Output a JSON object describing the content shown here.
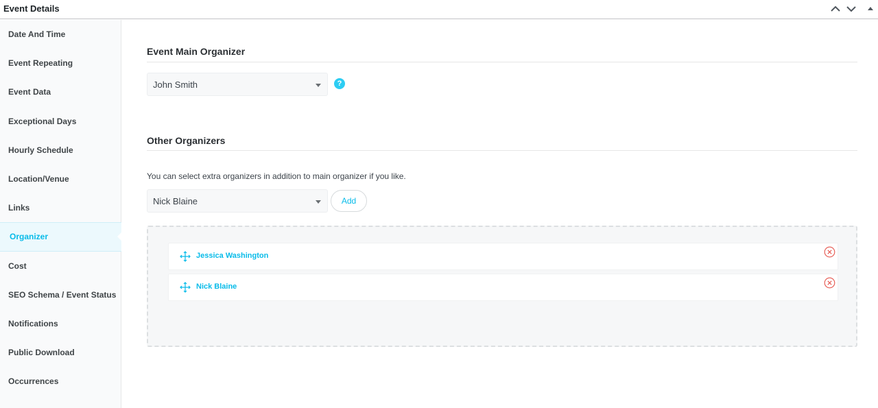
{
  "header": {
    "title": "Event Details",
    "controls": [
      "chevron-up-icon",
      "chevron-down-icon",
      "triangle-up-icon"
    ]
  },
  "sidebar": {
    "items": [
      {
        "label": "Date And Time",
        "active": false
      },
      {
        "label": "Event Repeating",
        "active": false
      },
      {
        "label": "Event Data",
        "active": false
      },
      {
        "label": "Exceptional Days",
        "active": false
      },
      {
        "label": "Hourly Schedule",
        "active": false
      },
      {
        "label": "Location/Venue",
        "active": false
      },
      {
        "label": "Links",
        "active": false
      },
      {
        "label": "Organizer",
        "active": true
      },
      {
        "label": "Cost",
        "active": false
      },
      {
        "label": "SEO Schema / Event Status",
        "active": false
      },
      {
        "label": "Notifications",
        "active": false
      },
      {
        "label": "Public Download",
        "active": false
      },
      {
        "label": "Occurrences",
        "active": false
      }
    ]
  },
  "main": {
    "main_organizer": {
      "title": "Event Main Organizer",
      "selected": "John Smith",
      "help_icon": "?"
    },
    "other_organizers": {
      "title": "Other Organizers",
      "description": "You can select extra organizers in addition to main organizer if you like.",
      "selected": "Nick Blaine",
      "add_label": "Add",
      "list": [
        {
          "name": "Jessica Washington"
        },
        {
          "name": "Nick Blaine"
        }
      ]
    }
  },
  "colors": {
    "accent": "#07bbe9",
    "help": "#2dcdf3",
    "remove": "#e5534b",
    "active_bg": "#ecf9fd"
  }
}
